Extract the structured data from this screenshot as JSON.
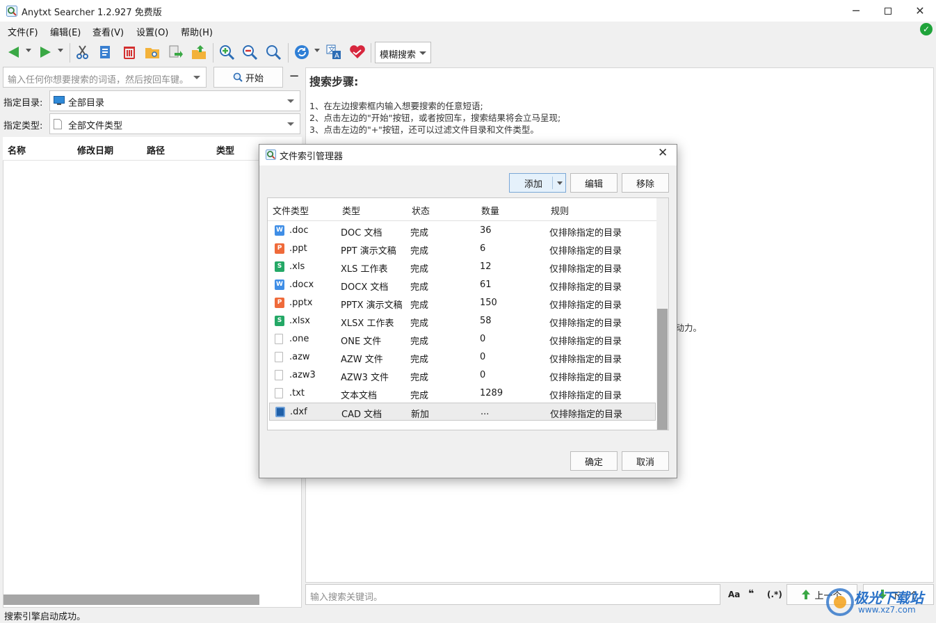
{
  "window": {
    "title": "Anytxt Searcher 1.2.927 免费版"
  },
  "menu": [
    "文件(F)",
    "编辑(E)",
    "查看(V)",
    "设置(O)",
    "帮助(H)"
  ],
  "toolbar": {
    "fuzzy_mode": "模糊搜索"
  },
  "search": {
    "placeholder": "输入任何你想要搜索的词语，然后按回车键。",
    "start_label": "开始"
  },
  "filters": {
    "dir_label": "指定目录:",
    "dir_value": "全部目录",
    "type_label": "指定类型:",
    "type_value": "全部文件类型"
  },
  "results": {
    "columns": [
      "名称",
      "修改日期",
      "路径",
      "类型"
    ]
  },
  "preview": {
    "title": "搜索步骤:",
    "steps": [
      "1、在左边搜索框内输入想要搜索的任意短语;",
      "2、点击左边的\"开始\"按钮，或者按回车，搜索结果将会立马呈现;",
      "3、点击左边的\"+\"按钮，还可以过滤文件目录和文件类型。"
    ],
    "side_text": "大动力。",
    "keyword_placeholder": "输入搜索关键词。",
    "opt_case": "Aa",
    "opt_quote": "❝",
    "opt_regex": "(.*)",
    "prev_label": "上一个",
    "next_label": "下一个"
  },
  "status": {
    "text": "搜索引擎启动成功。"
  },
  "watermark": {
    "brand": "极光下载站",
    "url": "www.xz7.com"
  },
  "dialog": {
    "title": "文件索引管理器",
    "add": "添加",
    "edit": "编辑",
    "remove": "移除",
    "ok": "确定",
    "cancel": "取消",
    "columns": [
      "文件类型",
      "类型",
      "状态",
      "数量",
      "规则"
    ],
    "rows": [
      {
        "icon": "doc",
        "ext": ".doc",
        "type": "DOC 文档",
        "status": "完成",
        "count": "36",
        "rule": "仅排除指定的目录"
      },
      {
        "icon": "ppt",
        "ext": ".ppt",
        "type": "PPT 演示文稿",
        "status": "完成",
        "count": "6",
        "rule": "仅排除指定的目录"
      },
      {
        "icon": "xls",
        "ext": ".xls",
        "type": "XLS 工作表",
        "status": "完成",
        "count": "12",
        "rule": "仅排除指定的目录"
      },
      {
        "icon": "doc",
        "ext": ".docx",
        "type": "DOCX 文档",
        "status": "完成",
        "count": "61",
        "rule": "仅排除指定的目录"
      },
      {
        "icon": "ppt",
        "ext": ".pptx",
        "type": "PPTX 演示文稿",
        "status": "完成",
        "count": "150",
        "rule": "仅排除指定的目录"
      },
      {
        "icon": "xls",
        "ext": ".xlsx",
        "type": "XLSX 工作表",
        "status": "完成",
        "count": "58",
        "rule": "仅排除指定的目录"
      },
      {
        "icon": "blank",
        "ext": ".one",
        "type": "ONE 文件",
        "status": "完成",
        "count": "0",
        "rule": "仅排除指定的目录"
      },
      {
        "icon": "blank",
        "ext": ".azw",
        "type": "AZW 文件",
        "status": "完成",
        "count": "0",
        "rule": "仅排除指定的目录"
      },
      {
        "icon": "blank",
        "ext": ".azw3",
        "type": "AZW3 文件",
        "status": "完成",
        "count": "0",
        "rule": "仅排除指定的目录"
      },
      {
        "icon": "txt",
        "ext": ".txt",
        "type": "文本文档",
        "status": "完成",
        "count": "1289",
        "rule": "仅排除指定的目录"
      },
      {
        "icon": "cad",
        "ext": ".dxf",
        "type": "CAD 文档",
        "status": "新加",
        "count": "...",
        "rule": "仅排除指定的目录",
        "selected": true
      }
    ]
  }
}
